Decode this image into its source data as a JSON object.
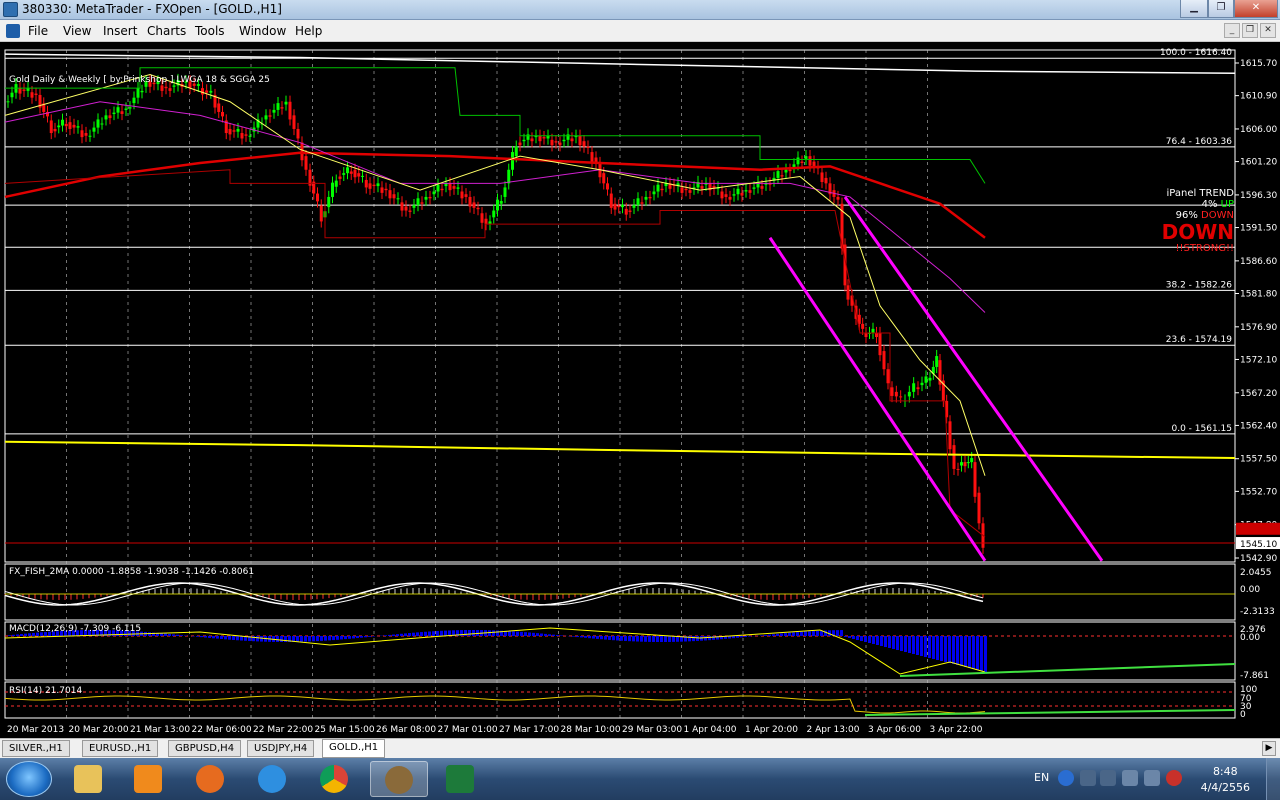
{
  "window": {
    "title": "380330: MetaTrader - FXOpen - [GOLD.,H1]"
  },
  "menu": [
    "File",
    "View",
    "Insert",
    "Charts",
    "Tools",
    "Window",
    "Help"
  ],
  "chart": {
    "header": "Gold Daily & Weekly [ by:Prinkshop ] LWGA 18 & SGGA 25",
    "price_ticks": [
      "1615.70",
      "1610.90",
      "1606.00",
      "1601.20",
      "1596.30",
      "1591.50",
      "1586.60",
      "1581.80",
      "1576.90",
      "1572.10",
      "1567.20",
      "1562.40",
      "1557.50",
      "1552.70",
      "1547.80",
      "1542.90"
    ],
    "current_price": "1545.10",
    "fib_levels": [
      {
        "label": "100.0 - 1616.40"
      },
      {
        "label": "76.4 - 1603.36"
      },
      {
        "label": "38.2 - 1582.26"
      },
      {
        "label": "23.6 - 1574.19"
      },
      {
        "label": "0.0 - 1561.15"
      }
    ],
    "time_labels": [
      "20 Mar 2013",
      "20 Mar 20:00",
      "21 Mar 13:00",
      "22 Mar 06:00",
      "22 Mar 22:00",
      "25 Mar 15:00",
      "26 Mar 08:00",
      "27 Mar 01:00",
      "27 Mar 17:00",
      "28 Mar 10:00",
      "29 Mar 03:00",
      "1 Apr 04:00",
      "1 Apr 20:00",
      "2 Apr 13:00",
      "3 Apr 06:00",
      "3 Apr 22:00"
    ]
  },
  "ipanel": {
    "title": "iPanel TREND",
    "up_pct": "4%",
    "up_label": "UP",
    "down_pct": "96%",
    "down_label": "DOWN",
    "big": "DOWN",
    "strong": "!!STRONG!!",
    "colors": {
      "up": "#00ff00",
      "down": "#ff2020",
      "text": "#ffffff"
    }
  },
  "indicators": {
    "fx_fish": {
      "label": "FX_FISH_2MA 0.0000 -1.8858 -1.9038 -1.1426 -0.8061",
      "ticks": [
        "2.0455",
        "0.00",
        "-2.3133"
      ]
    },
    "macd": {
      "label": "MACD(12,26,9) -7.309 -6.115",
      "ticks": [
        "2.976",
        "0.00",
        "-7.861"
      ]
    },
    "rsi": {
      "label": "RSI(14) 21.7014",
      "ticks": [
        "100",
        "70",
        "30",
        "0"
      ]
    }
  },
  "tabs": [
    {
      "label": "SILVER.,H1",
      "active": false
    },
    {
      "label": "EURUSD.,H1",
      "active": false
    },
    {
      "label": "GBPUSD,H4",
      "active": false
    },
    {
      "label": "USDJPY,H4",
      "active": false
    },
    {
      "label": "GOLD.,H1",
      "active": true
    }
  ],
  "taskbar": {
    "apps": [
      {
        "name": "file-explorer",
        "color": "#e8c25a"
      },
      {
        "name": "media-player",
        "color": "#f08a1c"
      },
      {
        "name": "firefox",
        "color": "#e66b1f"
      },
      {
        "name": "internet-explorer",
        "color": "#2e8fe0"
      },
      {
        "name": "chrome",
        "color": "#3aa757"
      },
      {
        "name": "metatrader",
        "color": "#8a6a3a"
      },
      {
        "name": "excel",
        "color": "#1d7a3a"
      }
    ],
    "language": "EN",
    "time": "8:48",
    "date": "4/4/2556"
  }
}
